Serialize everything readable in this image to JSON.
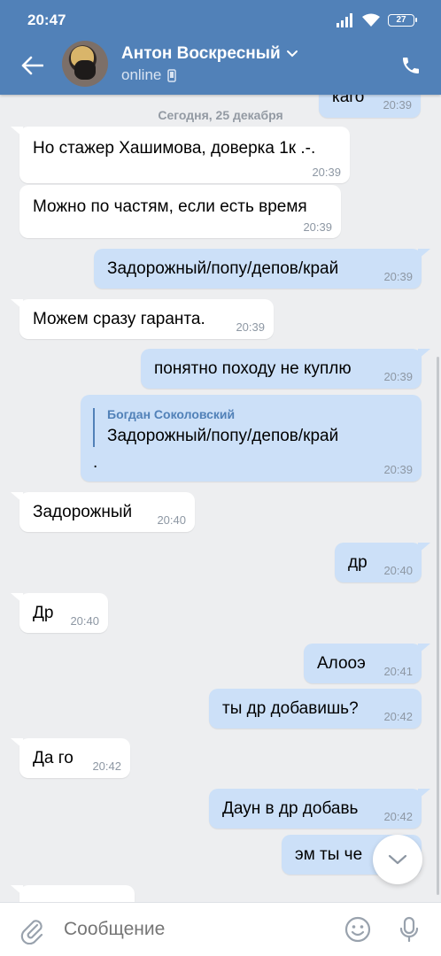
{
  "status_bar": {
    "time": "20:47",
    "battery": "27"
  },
  "header": {
    "contact_name": "Антон Воскресный",
    "contact_status": "online",
    "icons": [
      "back-arrow-icon",
      "chevron-down-icon",
      "mobile-device-icon",
      "phone-icon"
    ]
  },
  "chat": {
    "date_separator": "Сегодня, 25 декабря",
    "messages": [
      {
        "direction": "out",
        "text": "каго",
        "time": "20:39"
      },
      {
        "direction": "in",
        "text": "Но стажер Хашимова, доверка 1к .-.",
        "time": "20:39"
      },
      {
        "direction": "in",
        "text": "Можно по частям, если есть время",
        "time": "20:39"
      },
      {
        "direction": "out",
        "text": "Задорожный/попу/депов/край",
        "time": "20:39"
      },
      {
        "direction": "in",
        "text": "Можем сразу гаранта.",
        "time": "20:39"
      },
      {
        "direction": "out",
        "text": "понятно походу не куплю",
        "time": "20:39"
      },
      {
        "direction": "out",
        "reply_author": "Богдан Соколовский",
        "reply_text": "Задорожный/попу/депов/край",
        "text": ".",
        "time": "20:39"
      },
      {
        "direction": "in",
        "text": "Задорожный",
        "time": "20:40"
      },
      {
        "direction": "out",
        "text": "др",
        "time": "20:40"
      },
      {
        "direction": "in",
        "text": "Др",
        "time": "20:40"
      },
      {
        "direction": "out",
        "text": "Алооэ",
        "time": "20:41"
      },
      {
        "direction": "out",
        "text": "ты др добавишь?",
        "time": "20:42"
      },
      {
        "direction": "in",
        "text": "Да го",
        "time": "20:42"
      },
      {
        "direction": "out",
        "text": "Даун в др добавь",
        "time": "20:42"
      },
      {
        "direction": "out",
        "text": "эм ты че",
        "time": ""
      }
    ]
  },
  "composer": {
    "placeholder": "Сообщение",
    "icons": [
      "paperclip-icon",
      "emoji-icon",
      "microphone-icon",
      "scroll-down-chevron-icon"
    ]
  },
  "colors": {
    "header": "#5181b8",
    "outgoing_bubble": "#cce0f8",
    "incoming_bubble": "#ffffff",
    "background": "#edeef0"
  }
}
